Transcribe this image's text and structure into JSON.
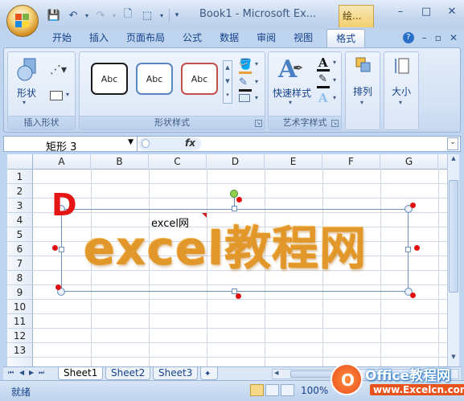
{
  "window": {
    "title": "Book1 - Microsoft Ex...",
    "tool_tab": "绘...",
    "controls": [
      "–",
      "□",
      "✕"
    ]
  },
  "ribbon": {
    "tabs": [
      {
        "label": "开始"
      },
      {
        "label": "插入"
      },
      {
        "label": "页面布局"
      },
      {
        "label": "公式"
      },
      {
        "label": "数据"
      },
      {
        "label": "审阅"
      },
      {
        "label": "视图"
      },
      {
        "label": "格式",
        "active": true
      }
    ],
    "groups": {
      "insert_shape": {
        "label": "插入形状",
        "shape_button": "形状"
      },
      "shape_styles": {
        "label": "形状样式",
        "style_samples": [
          "Abc",
          "Abc",
          "Abc"
        ],
        "style_colors": [
          "#1a1a1a",
          "#5a86c2",
          "#c4504d"
        ]
      },
      "wordart_styles": {
        "label": "艺术字样式",
        "quick_style": "快速样式"
      },
      "arrange": {
        "label": "排列"
      },
      "size": {
        "label": "大小"
      }
    }
  },
  "formula_bar": {
    "name_box": "矩形 3",
    "fx": "fx"
  },
  "sheet": {
    "columns": [
      "A",
      "B",
      "C",
      "D",
      "E",
      "F",
      "G"
    ],
    "rows": [
      "1",
      "2",
      "3",
      "4",
      "5",
      "6",
      "7",
      "8",
      "9",
      "10",
      "11",
      "12",
      "13"
    ],
    "shape_text": "excel教程网",
    "shape_caption": "excel网",
    "annotation": "D"
  },
  "sheet_tabs": [
    {
      "label": "Sheet1",
      "active": true
    },
    {
      "label": "Sheet2"
    },
    {
      "label": "Sheet3"
    }
  ],
  "status": {
    "text": "就绪",
    "zoom": "100%"
  },
  "watermark": {
    "logo_letter": "O",
    "title": "Office教程网",
    "url": "www.Excelcn.com"
  },
  "colors": {
    "accent": "#15428b",
    "wordart": "#f5b14a",
    "marker": "#e01010"
  }
}
